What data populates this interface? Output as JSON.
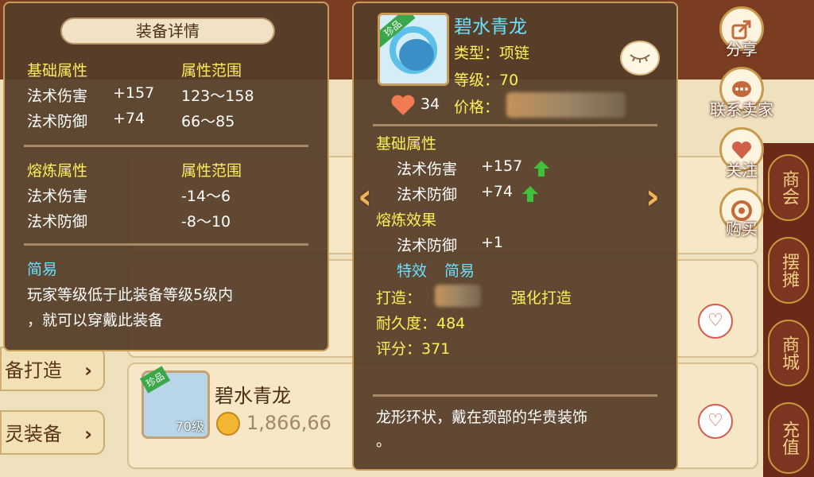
{
  "background": {
    "side_buttons": [
      "备打造",
      "灵装备"
    ],
    "list_items": [
      {
        "name": "碧水青龙",
        "level": "70级",
        "tag": "珍品",
        "price": "1,866,66"
      }
    ],
    "right_rail": [
      "商会",
      "摆摊",
      "商城",
      "充值"
    ]
  },
  "actions": [
    {
      "label": "分享",
      "icon": "share-icon"
    },
    {
      "label": "联系卖家",
      "icon": "chat-icon"
    },
    {
      "label": "关注",
      "icon": "heart-icon"
    },
    {
      "label": "购买",
      "icon": "buy-icon"
    }
  ],
  "detail_panel": {
    "title": "装备详情",
    "base": {
      "header": "基础属性",
      "range_header": "属性范围",
      "rows": [
        {
          "name": "法术伤害",
          "value": "+157",
          "range": "123～158"
        },
        {
          "name": "法术防御",
          "value": "+74",
          "range": "66～85"
        }
      ]
    },
    "smelt": {
      "header": "熔炼属性",
      "range_header": "属性范围",
      "rows": [
        {
          "name": "法术伤害",
          "range": "-14～6"
        },
        {
          "name": "法术防御",
          "range": "-8～10"
        }
      ]
    },
    "special": {
      "name": "简易",
      "desc_line1": "玩家等级低于此装备等级5级内",
      "desc_line2": "，就可以穿戴此装备"
    }
  },
  "item_panel": {
    "icon_tag": "珍品",
    "name": "碧水青龙",
    "type": "类型：项链",
    "level": "等级：70",
    "likes": "34",
    "price_label": "价格：",
    "base_header": "基础属性",
    "base_rows": [
      {
        "name": "法术伤害",
        "value": "+157"
      },
      {
        "name": "法术防御",
        "value": "+74"
      }
    ],
    "smelt_header": "熔炼效果",
    "smelt_row": {
      "name": "法术防御",
      "value": "+1"
    },
    "special_label": "特效",
    "special_value": "简易",
    "forge_label": "打造：",
    "forge_value": "强化打造",
    "durability": "耐久度：484",
    "score": "评分：371",
    "desc_line1": "龙形环状，戴在颈部的华贵装饰",
    "desc_line2": "。"
  },
  "colors": {
    "panel_bg": "#563e28",
    "panel_border": "#c79d5c",
    "header_yellow": "#fff05a",
    "special_cyan": "#66e2ff",
    "up_arrow_green": "#3fc23a"
  }
}
